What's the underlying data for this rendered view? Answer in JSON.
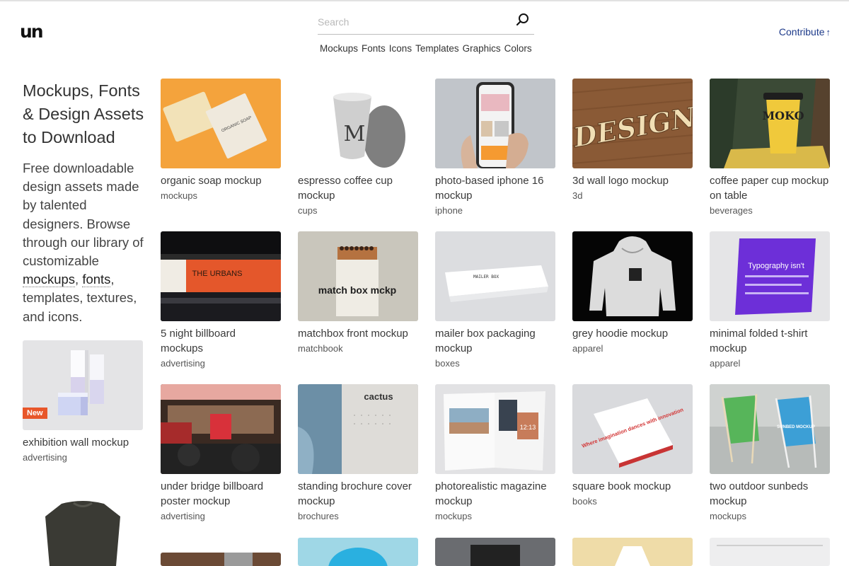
{
  "header": {
    "logo": "un",
    "search": {
      "placeholder": "Search",
      "value": ""
    },
    "nav": [
      "Mockups",
      "Fonts",
      "Icons",
      "Templates",
      "Graphics",
      "Colors"
    ],
    "contribute": "Contribute",
    "contribute_arrow": "↑"
  },
  "hero": {
    "title": "Mockups, Fonts & Design Assets to Download",
    "text_before": "Free downloadable design assets made by talented designers. Browse through our library of customizable ",
    "link_mockups": "mockups",
    "sep": ", ",
    "link_fonts": "fonts",
    "text_after": ", templates, textures, and icons."
  },
  "sidebar_cards": [
    {
      "title": "exhibition wall mockup",
      "category": "advertising",
      "badge": "New"
    }
  ],
  "cards": [
    {
      "title": "organic soap mockup",
      "category": "mockups",
      "thumb_text": "ORGANIC SOAP"
    },
    {
      "title": "espresso coffee cup mockup",
      "category": "cups",
      "thumb_text": "M"
    },
    {
      "title": "photo-based iphone 16 mockup",
      "category": "iphone"
    },
    {
      "title": "3d wall logo mockup",
      "category": "3d",
      "thumb_text": "DESIGN"
    },
    {
      "title": "coffee paper cup mockup on table",
      "category": "beverages",
      "thumb_text": "MOKO"
    },
    {
      "title": "5 night billboard mockups",
      "category": "advertising",
      "thumb_text": "THE URBANS"
    },
    {
      "title": "matchbox front mockup",
      "category": "matchbook",
      "thumb_text": "match box mckp"
    },
    {
      "title": "mailer box packaging mockup",
      "category": "boxes",
      "thumb_text": "MAILER BOX"
    },
    {
      "title": "grey hoodie mockup",
      "category": "apparel"
    },
    {
      "title": "minimal folded t-shirt mockup",
      "category": "apparel",
      "thumb_text": "Typography isn't"
    },
    {
      "title": "under bridge billboard poster mockup",
      "category": "advertising"
    },
    {
      "title": "standing brochure cover mockup",
      "category": "brochures",
      "thumb_text": "cactus"
    },
    {
      "title": "photorealistic magazine mockup",
      "category": "mockups",
      "thumb_text": "12:13"
    },
    {
      "title": "square book mockup",
      "category": "books",
      "thumb_text": "Where imagination dances with innovation"
    },
    {
      "title": "two outdoor sunbeds mockup",
      "category": "mockups",
      "thumb_text": "SUNBED MOCKUP"
    }
  ],
  "colors": {
    "accent": "#1d3a8a",
    "badge": "#e8562a"
  }
}
